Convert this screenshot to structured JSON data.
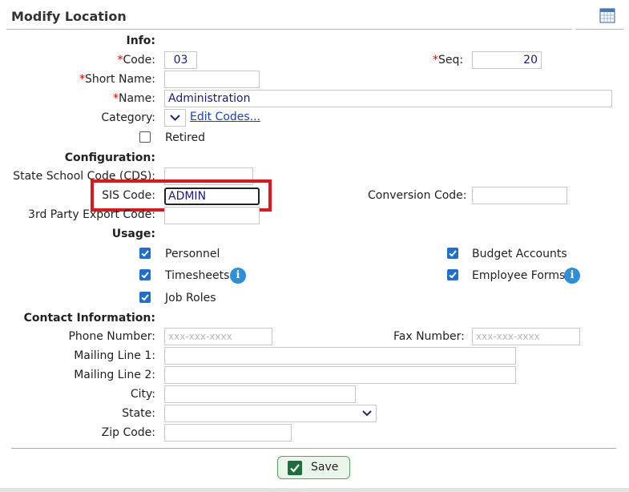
{
  "header": {
    "title": "Modify Location",
    "calendar_icon": "calendar-icon"
  },
  "sections": {
    "info": "Info:",
    "configuration": "Configuration:",
    "usage": "Usage:",
    "contact": "Contact Information:"
  },
  "required_mark": "*",
  "fields": {
    "code": {
      "label": "Code:",
      "value": "03"
    },
    "seq": {
      "label": "Seq:",
      "value": "20"
    },
    "short_name": {
      "label": "Short Name:",
      "value": ""
    },
    "name": {
      "label": "Name:",
      "value": "Administration"
    },
    "category": {
      "label": "Category:",
      "value": "",
      "edit_link": "Edit Codes..."
    },
    "retired": {
      "label": "Retired",
      "checked": false
    },
    "state_school_code": {
      "label": "State School Code (CDS):",
      "value": ""
    },
    "sis_code": {
      "label": "SIS Code:",
      "value": "ADMIN"
    },
    "conversion_code": {
      "label": "Conversion Code:",
      "value": ""
    },
    "third_party_export_code": {
      "label": "3rd Party Export Code:",
      "value": ""
    },
    "phone_number": {
      "label": "Phone Number:",
      "placeholder": "xxx-xxx-xxxx"
    },
    "fax_number": {
      "label": "Fax Number:",
      "placeholder": "xxx-xxx-xxxx"
    },
    "mailing_line_1": {
      "label": "Mailing Line 1:",
      "value": ""
    },
    "mailing_line_2": {
      "label": "Mailing Line 2:",
      "value": ""
    },
    "city": {
      "label": "City:",
      "value": ""
    },
    "state": {
      "label": "State:",
      "value": ""
    },
    "zip_code": {
      "label": "Zip Code:",
      "value": ""
    }
  },
  "usage": {
    "personnel": {
      "label": "Personnel",
      "checked": true
    },
    "timesheets": {
      "label": "Timesheets",
      "checked": true
    },
    "job_roles": {
      "label": "Job Roles",
      "checked": true
    },
    "budget_accounts": {
      "label": "Budget Accounts",
      "checked": true
    },
    "employee_forms": {
      "label": "Employee Forms",
      "checked": true
    }
  },
  "info_icon_glyph": "i",
  "save_button": {
    "label": "Save"
  },
  "colors": {
    "highlight": "#e0161c",
    "checkbox": "#1f6fd0",
    "info_icon": "#2d8fd8",
    "save_check": "#1d6e3c"
  }
}
